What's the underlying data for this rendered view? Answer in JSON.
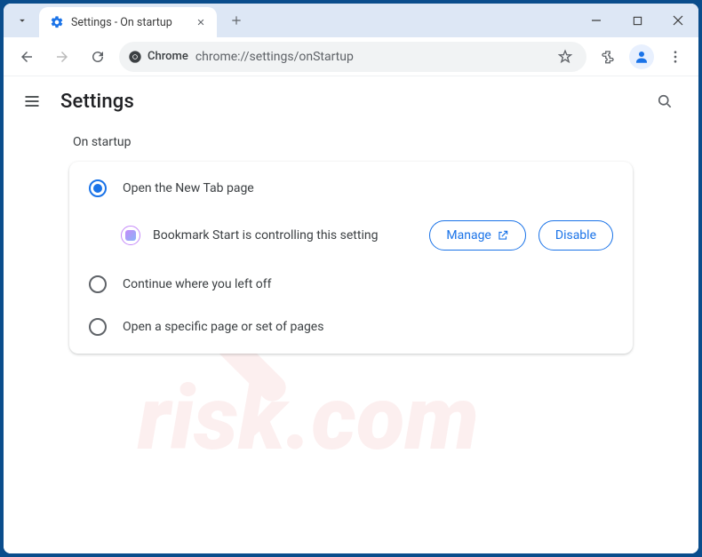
{
  "window": {
    "tab_title": "Settings - On startup"
  },
  "toolbar": {
    "omnibox_chip": "Chrome",
    "omnibox_url": "chrome://settings/onStartup"
  },
  "settings": {
    "title": "Settings",
    "section_label": "On startup",
    "options": {
      "open_new_tab": "Open the New Tab page",
      "continue": "Continue where you left off",
      "specific": "Open a specific page or set of pages"
    },
    "extension_notice": "Bookmark Start is controlling this setting",
    "manage_label": "Manage",
    "disable_label": "Disable"
  }
}
